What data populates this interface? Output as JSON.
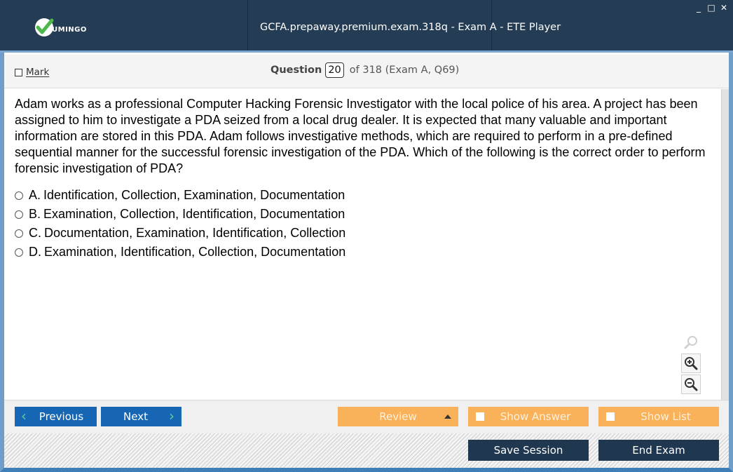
{
  "window": {
    "title": "GCFA.prepaway.premium.exam.318q - Exam A - ETE Player",
    "controls": [
      "_",
      "□",
      "✕"
    ],
    "logo_text": "UMINGO",
    "accent_color": "#243c54"
  },
  "header": {
    "mark_label": "Mark",
    "question_label": "Question",
    "question_number": "20",
    "question_of": "of 318 (Exam A, Q69)"
  },
  "question": {
    "text": "Adam works as a professional Computer Hacking Forensic Investigator with the local police of his area. A project has been assigned to him to investigate a PDA seized from a local drug dealer. It is expected that many valuable and important information are stored in this PDA. Adam follows investigative methods, which are required to perform in a pre-defined sequential manner for the successful forensic investigation of the PDA. Which of the following is the correct order to perform forensic investigation of PDA?",
    "answers": [
      {
        "letter": "A.",
        "text": "Identification, Collection, Examination, Documentation"
      },
      {
        "letter": "B.",
        "text": "Examination, Collection, Identification, Documentation"
      },
      {
        "letter": "C.",
        "text": "Documentation, Examination, Identification, Collection"
      },
      {
        "letter": "D.",
        "text": "Examination, Identification, Collection, Documentation"
      }
    ]
  },
  "zoom_icons": [
    "search-icon",
    "zoom-in-icon",
    "zoom-out-icon"
  ],
  "nav": {
    "previous": "Previous",
    "next": "Next",
    "review": "Review",
    "show_answer": "Show Answer",
    "show_list": "Show List",
    "save_session": "Save Session",
    "end_exam": "End Exam"
  },
  "colors": {
    "nav_blue": "#1666b3",
    "nav_orange": "#f9b15a",
    "nav_dark": "#203750",
    "check_green": "#5fcf8b"
  }
}
